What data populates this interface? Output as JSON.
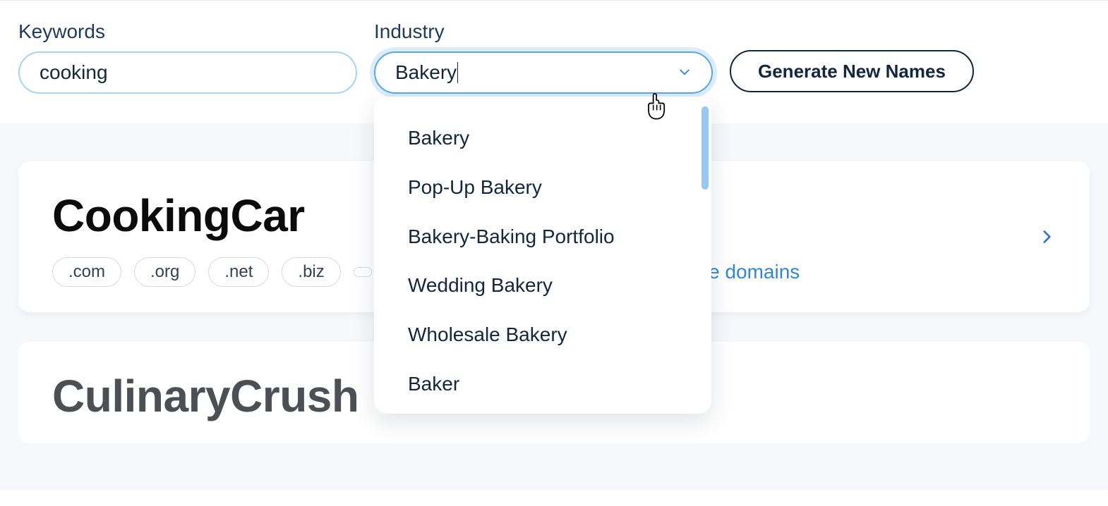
{
  "form": {
    "keywords_label": "Keywords",
    "keywords_value": "cooking",
    "industry_label": "Industry",
    "industry_value": "Bakery",
    "generate_label": "Generate New Names"
  },
  "dropdown": {
    "options": [
      "Bakery",
      "Pop-Up Bakery",
      "Bakery-Baking Portfolio",
      "Wedding Bakery",
      "Wholesale Bakery",
      "Baker"
    ]
  },
  "results": [
    {
      "name": "CookingCar",
      "domains": [
        ".com",
        ".org",
        ".net",
        ".biz"
      ],
      "more_domains_text": "re domains"
    },
    {
      "name": "CulinaryCrush"
    }
  ]
}
